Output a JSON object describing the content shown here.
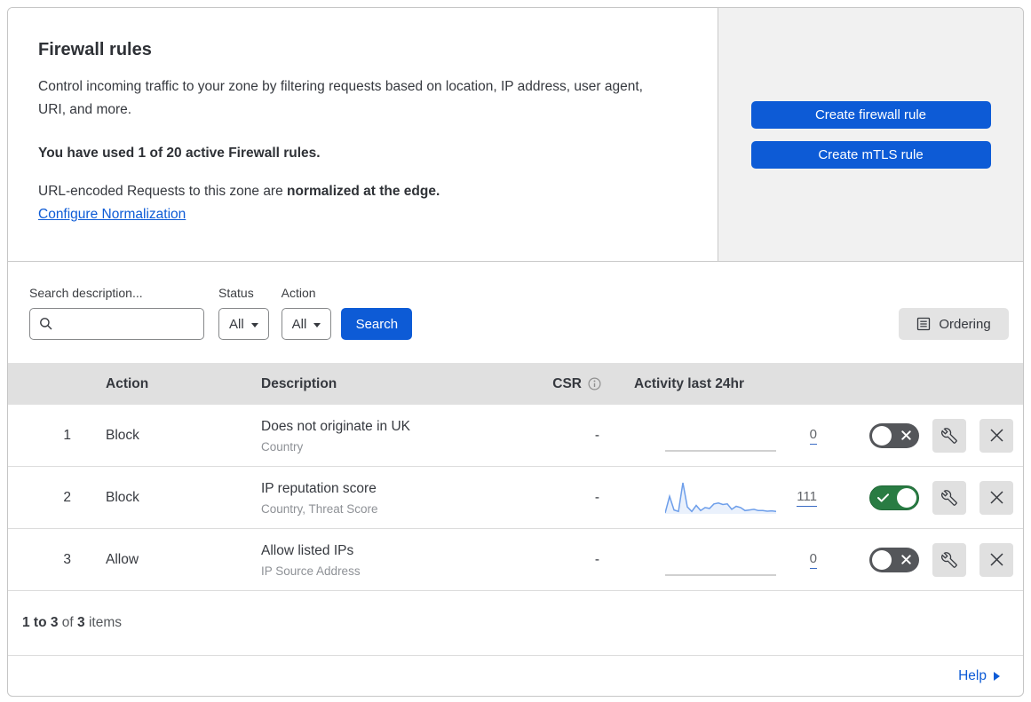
{
  "header": {
    "title": "Firewall rules",
    "description": "Control incoming traffic to your zone by filtering requests based on location, IP address, user agent, URI, and more.",
    "usage_text": "You have used 1 of 20 active Firewall rules.",
    "normalization_prefix": "URL-encoded Requests to this zone are",
    "normalization_bold": "normalized at the edge.",
    "normalization_link": "Configure Normalization",
    "create_firewall_button": "Create firewall rule",
    "create_mtls_button": "Create mTLS rule"
  },
  "filters": {
    "search_label": "Search description...",
    "status_label": "Status",
    "status_value": "All",
    "action_label": "Action",
    "action_value": "All",
    "search_button": "Search",
    "ordering_button": "Ordering"
  },
  "table": {
    "columns": [
      "Action",
      "Description",
      "CSR",
      "Activity last 24hr"
    ],
    "rows": [
      {
        "index": "1",
        "action": "Block",
        "description": "Does not originate in UK",
        "fields": "Country",
        "csr": "-",
        "activity_count": "0",
        "enabled": false,
        "sparkline": [
          0,
          0,
          0,
          0,
          0,
          0,
          0,
          0,
          0,
          0,
          0,
          0,
          0,
          0,
          0,
          0,
          0,
          0,
          0,
          0,
          0,
          0,
          0,
          0,
          0,
          0
        ]
      },
      {
        "index": "2",
        "action": "Block",
        "description": "IP reputation score",
        "fields": "Country, Threat Score",
        "csr": "-",
        "activity_count": "111",
        "enabled": true,
        "sparkline": [
          0,
          55,
          10,
          5,
          100,
          20,
          5,
          25,
          8,
          18,
          15,
          30,
          33,
          28,
          30,
          12,
          22,
          18,
          8,
          10,
          12,
          8,
          8,
          6,
          7,
          5
        ]
      },
      {
        "index": "3",
        "action": "Allow",
        "description": "Allow listed IPs",
        "fields": "IP Source Address",
        "csr": "-",
        "activity_count": "0",
        "enabled": false,
        "sparkline": [
          0,
          0,
          0,
          0,
          0,
          0,
          0,
          0,
          0,
          0,
          0,
          0,
          0,
          0,
          0,
          0,
          0,
          0,
          0,
          0,
          0,
          0,
          0,
          0,
          0,
          0
        ]
      }
    ]
  },
  "footer": {
    "items_range": "1 to 3",
    "of_text": "of",
    "items_total": "3",
    "items_text": "items",
    "help_link": "Help"
  },
  "colors": {
    "primary_blue": "#0d5bd6",
    "toggle_on_green": "#297c43",
    "toggle_off_gray": "#54565a",
    "sparkline_blue": "#6d9eea"
  }
}
